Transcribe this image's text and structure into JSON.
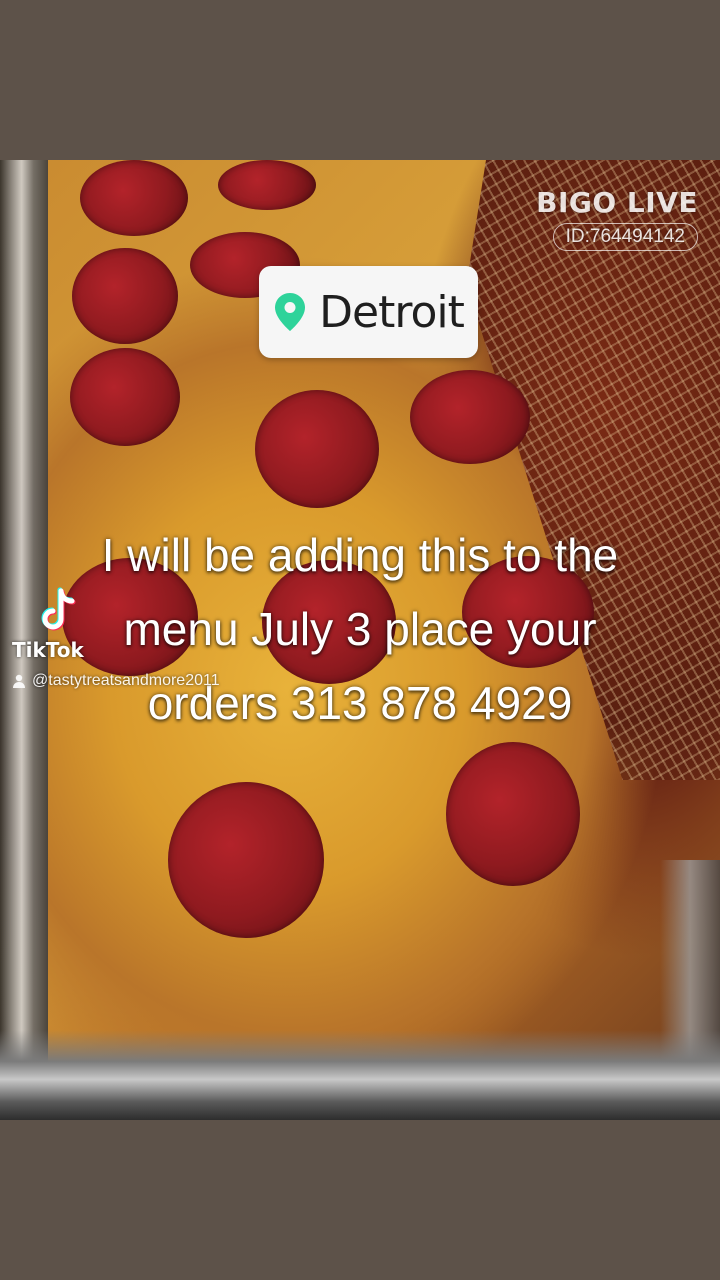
{
  "watermark": {
    "brand": "BIGO LIVE",
    "id": "ID:764494142"
  },
  "location": {
    "icon": "map-pin-icon",
    "name": "Detroit",
    "pin_color": "#2ed39a"
  },
  "caption": {
    "line1": "I will be adding this to the",
    "line2": "menu July 3 place your",
    "line3": "orders 313 878 4929"
  },
  "tiktok": {
    "logo": "tiktok-logo",
    "brand": "TikTok",
    "username": "@tastytreatsandmore2011"
  }
}
